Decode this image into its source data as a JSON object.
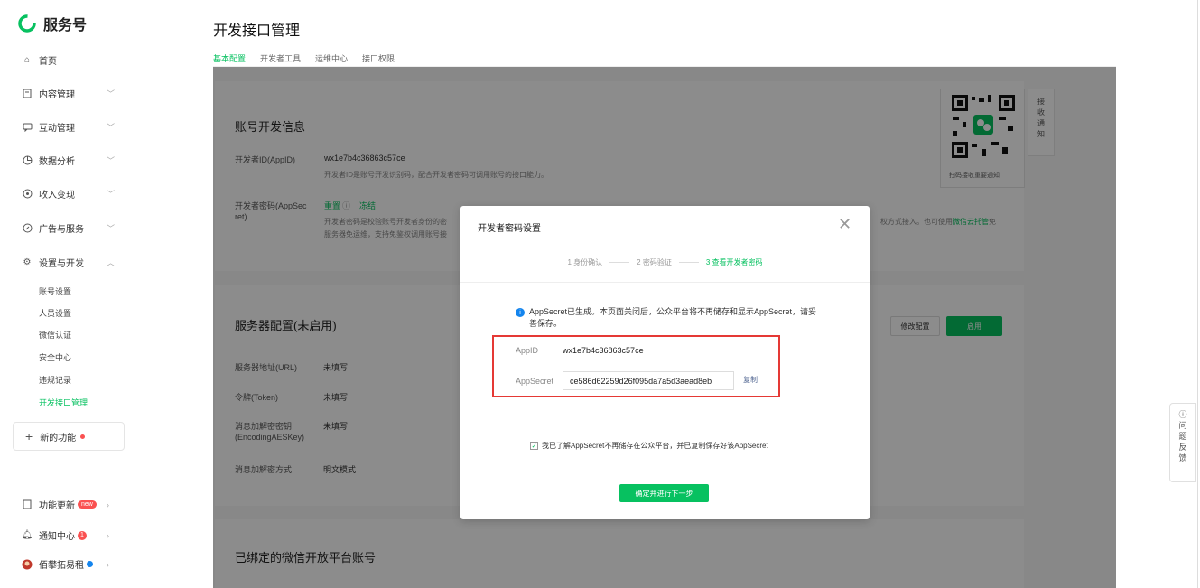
{
  "brand": {
    "name": "服务号"
  },
  "sidebar": {
    "items": [
      {
        "label": "首页",
        "icon": "home-icon"
      },
      {
        "label": "内容管理",
        "icon": "document-icon"
      },
      {
        "label": "互动管理",
        "icon": "chat-icon"
      },
      {
        "label": "数据分析",
        "icon": "chart-icon"
      },
      {
        "label": "收入变现",
        "icon": "coin-icon"
      },
      {
        "label": "广告与服务",
        "icon": "compass-icon"
      },
      {
        "label": "设置与开发",
        "icon": "gear-icon"
      }
    ],
    "sub_items": [
      "账号设置",
      "人员设置",
      "微信认证",
      "安全中心",
      "违规记录",
      "开发接口管理"
    ],
    "new_func": "新的功能",
    "bottom": [
      {
        "label": "功能更新",
        "badge": "new"
      },
      {
        "label": "通知中心",
        "badge": "1"
      },
      {
        "label": "佰攀拓易租"
      }
    ]
  },
  "header": {
    "title": "开发接口管理",
    "tabs": [
      "基本配置",
      "开发者工具",
      "运维中心",
      "接口权限"
    ]
  },
  "dev_info": {
    "title": "账号开发信息",
    "appid_label": "开发者ID(AppID)",
    "appid_value": "wx1e7b4c36863c57ce",
    "appid_desc": "开发者ID是账号开发识别码，配合开发者密码可调用账号的接口能力。",
    "secret_label_1": "开发者密码(AppSec",
    "secret_label_2": "ret)",
    "reset": "重置",
    "freeze": "冻结",
    "secret_desc_1": "开发者密码是校验账号开发者身份的密",
    "secret_desc_1b": "权方式接入。也可使用",
    "secret_desc_1c": "微信云托管",
    "secret_desc_1d": "免",
    "secret_desc_2": "服务器免运维，支持免鉴权调用账号接",
    "qr_caption": "扫码接收重要通知",
    "receive": [
      "接",
      "收",
      "通",
      "知"
    ]
  },
  "server_config": {
    "title": "服务器配置(未启用)",
    "modify": "修改配置",
    "enable": "启用",
    "rows": [
      {
        "label": "服务器地址(URL)",
        "value": "未填写"
      },
      {
        "label": "令牌(Token)",
        "value": "未填写"
      },
      {
        "label": "消息加解密密钥",
        "label2": "(EncodingAESKey)",
        "value": "未填写"
      },
      {
        "label": "消息加解密方式",
        "value": "明文模式"
      }
    ]
  },
  "bound": {
    "title": "已绑定的微信开放平台账号"
  },
  "feedback": [
    "问",
    "题",
    "反",
    "馈"
  ],
  "modal": {
    "title": "开发者密码设置",
    "steps": [
      "1 身份确认",
      "2 密码验证",
      "3 查看开发者密码"
    ],
    "notice": "AppSecret已生成。本页面关闭后，公众平台将不再储存和显示AppSecret，请妥善保存。",
    "appid_label": "AppID",
    "appid_value": "wx1e7b4c36863c57ce",
    "secret_label": "AppSecret",
    "secret_value": "ce586d62259d26f095da7a5d3aead8eb",
    "copy": "复制",
    "agree": "我已了解AppSecret不再储存在公众平台，并已复制保存好该AppSecret",
    "confirm": "确定并进行下一步"
  },
  "colors": {
    "accent": "#07c160",
    "danger": "#fa5151",
    "link": "#576b95",
    "highlight": "#e53935"
  }
}
